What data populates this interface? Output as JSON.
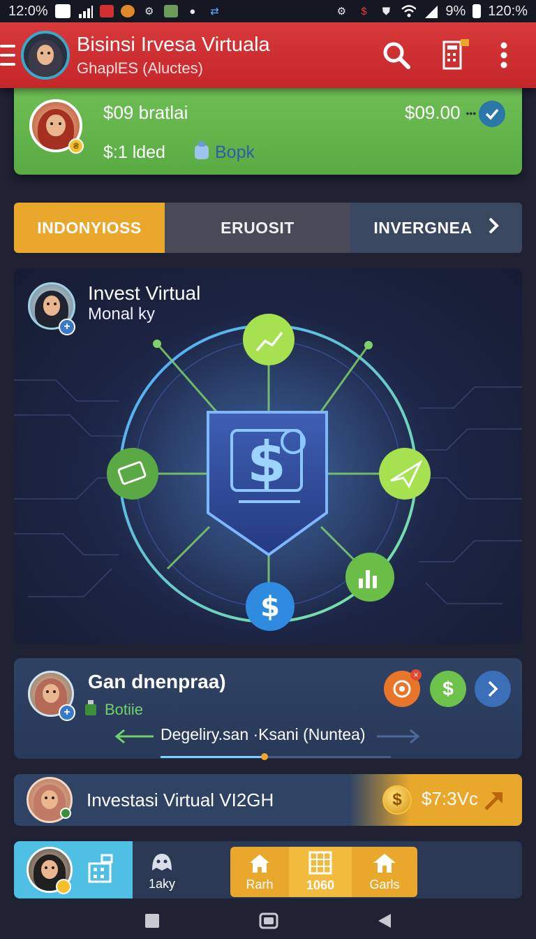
{
  "status_bar": {
    "time": "12:0%",
    "battery_text": "9%",
    "clock_right": "120:%"
  },
  "app_bar": {
    "title": "Bisinsi Irvesa Virtuala",
    "subtitle": "GhaplES (Aluctes)",
    "icons": [
      "menu-icon",
      "search-icon",
      "calculator-icon",
      "more-vert-icon"
    ]
  },
  "balance_card": {
    "line1": "$09  bratlai",
    "line2": "$:1 lded",
    "book_label": "Bopk",
    "amount": "$09.00",
    "dots": "•••",
    "coin_badge": "₴"
  },
  "tabs": [
    {
      "label": "INDONYIOSS",
      "active": true
    },
    {
      "label": "ERUOSIT",
      "active": false
    },
    {
      "label": "INVERGNEA",
      "active": false
    }
  ],
  "hero": {
    "title": "Invest Virtual",
    "subtitle": "Monal ky",
    "center_icon": "dollar-shield-icon",
    "nodes": [
      "chart-growth-icon",
      "stack-cash-icon",
      "send-plane-icon",
      "bar-chart-icon",
      "dollar-coin-icon"
    ],
    "colors": {
      "ring": "#62c8ff",
      "node_green": "#8ee04d",
      "node_blue": "#2f8be0"
    }
  },
  "investment_card": {
    "title": "Gan dnenpraa)",
    "tag": "Botiie",
    "message": "Degeliry.san ·Ksani (Nuntea)",
    "buttons": [
      "target-icon",
      "dollar-icon",
      "chevron-right-icon"
    ],
    "button_colors": [
      "#e8762a",
      "#6cc24a",
      "#3b6fb8"
    ],
    "progress": 0.45
  },
  "promo_card": {
    "title": "Investasi Virtual VI2GH",
    "coin": "$",
    "value": "$7:3Vc"
  },
  "bottom_nav": {
    "items": [
      {
        "icon": "building-icon",
        "label": ""
      },
      {
        "icon": "ghost-icon",
        "label": "1aky"
      },
      {
        "icon": "store-icon",
        "label": "Rarh"
      },
      {
        "icon": "office-icon",
        "label": "1060"
      },
      {
        "icon": "house-icon",
        "label": "Garls"
      }
    ]
  },
  "system_nav": [
    "recents-icon",
    "home-icon",
    "back-icon"
  ]
}
